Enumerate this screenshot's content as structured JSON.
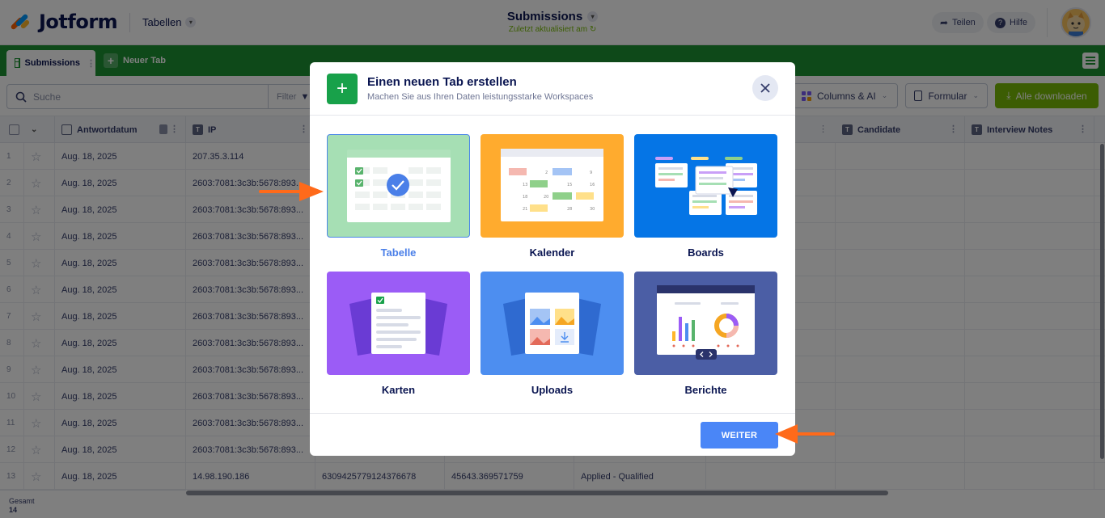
{
  "app": {
    "logo_text": "Jotform",
    "product": "Tabellen",
    "title": "Submissions",
    "subtitle": "Zuletzt aktualisiert am",
    "share_label": "Teilen",
    "help_label": "Hilfe"
  },
  "tabs": {
    "active": "Submissions",
    "new_tab": "Neuer Tab"
  },
  "toolbar": {
    "search_placeholder": "Suche",
    "filter_label": "Filter",
    "columns_label": "Columns & AI",
    "form_label": "Formular",
    "download_label": "Alle downloaden"
  },
  "grid": {
    "columns": [
      "Antwortdatum",
      "IP",
      "Candidate",
      "Interview Notes"
    ],
    "rows": [
      {
        "n": "1",
        "date": "Aug. 18, 2025",
        "ip": "207.35.3.114"
      },
      {
        "n": "2",
        "date": "Aug. 18, 2025",
        "ip": "2603:7081:3c3b:5678:893..."
      },
      {
        "n": "3",
        "date": "Aug. 18, 2025",
        "ip": "2603:7081:3c3b:5678:893..."
      },
      {
        "n": "4",
        "date": "Aug. 18, 2025",
        "ip": "2603:7081:3c3b:5678:893..."
      },
      {
        "n": "5",
        "date": "Aug. 18, 2025",
        "ip": "2603:7081:3c3b:5678:893..."
      },
      {
        "n": "6",
        "date": "Aug. 18, 2025",
        "ip": "2603:7081:3c3b:5678:893..."
      },
      {
        "n": "7",
        "date": "Aug. 18, 2025",
        "ip": "2603:7081:3c3b:5678:893..."
      },
      {
        "n": "8",
        "date": "Aug. 18, 2025",
        "ip": "2603:7081:3c3b:5678:893..."
      },
      {
        "n": "9",
        "date": "Aug. 18, 2025",
        "ip": "2603:7081:3c3b:5678:893..."
      },
      {
        "n": "10",
        "date": "Aug. 18, 2025",
        "ip": "2603:7081:3c3b:5678:893..."
      },
      {
        "n": "11",
        "date": "Aug. 18, 2025",
        "ip": "2603:7081:3c3b:5678:893..."
      },
      {
        "n": "12",
        "date": "Aug. 18, 2025",
        "ip": "2603:7081:3c3b:5678:893..."
      },
      {
        "n": "13",
        "date": "Aug. 18, 2025",
        "ip": "14.98.190.186",
        "c4": "6309425779124376678",
        "c5": "45643.369571759",
        "c6": "Applied - Qualified"
      }
    ],
    "footer_label": "Gesamt",
    "footer_count": "14"
  },
  "modal": {
    "title": "Einen neuen Tab erstellen",
    "subtitle": "Machen Sie aus Ihren Daten leistungsstarke Workspaces",
    "options": [
      "Tabelle",
      "Kalender",
      "Boards",
      "Karten",
      "Uploads",
      "Berichte"
    ],
    "selected": "Tabelle",
    "next_button": "WEITER"
  },
  "colors": {
    "brand_green": "#1d9233",
    "accent_blue": "#4a86f7",
    "download_green": "#78bb07",
    "arrow_orange": "#ff6a1a"
  }
}
